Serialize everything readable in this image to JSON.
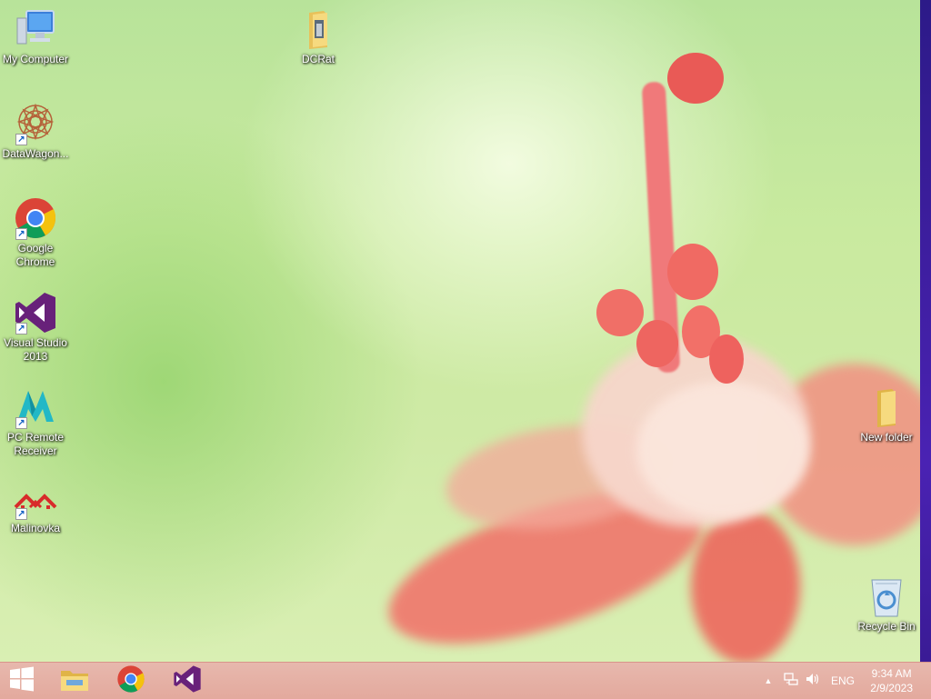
{
  "desktop": {
    "icons": [
      {
        "label": "My Computer",
        "icon": "computer-icon"
      },
      {
        "label": "DataWagon...",
        "icon": "datawagon-icon"
      },
      {
        "label": "Google Chrome",
        "icon": "chrome-icon"
      },
      {
        "label": "Visual Studio 2013",
        "icon": "visual-studio-icon"
      },
      {
        "label": "PC Remote Receiver",
        "icon": "pc-remote-icon"
      },
      {
        "label": "Malinovka",
        "icon": "malinovka-icon"
      },
      {
        "label": "DCRat",
        "icon": "folder-icon"
      },
      {
        "label": "New folder",
        "icon": "folder-icon"
      },
      {
        "label": "Recycle Bin",
        "icon": "recycle-bin-icon"
      }
    ]
  },
  "taskbar": {
    "pinned": [
      {
        "name": "start",
        "icon": "windows-logo-icon"
      },
      {
        "name": "file-explorer",
        "icon": "file-explorer-icon"
      },
      {
        "name": "chrome",
        "icon": "chrome-icon"
      },
      {
        "name": "visual-studio",
        "icon": "visual-studio-icon"
      }
    ],
    "tray": {
      "language": "ENG",
      "time": "9:34 AM",
      "date": "2/9/2023"
    }
  },
  "colors": {
    "taskbar": "#e3a99d",
    "vs_purple": "#68217a",
    "chrome_red": "#db4437",
    "chrome_yellow": "#f4c20d",
    "chrome_green": "#0f9d58",
    "chrome_blue": "#4285f4"
  }
}
